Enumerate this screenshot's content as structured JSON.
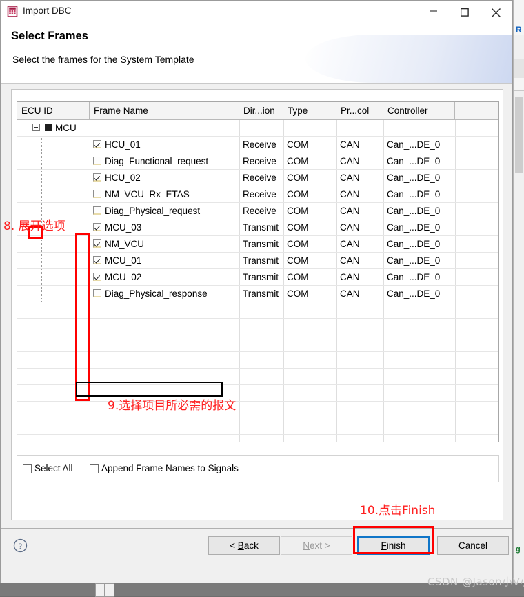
{
  "window": {
    "title": "Import DBC",
    "icon": "dbc-file-icon",
    "controls": {
      "minimize": "minimize-icon",
      "maximize": "maximize-icon",
      "close": "close-icon"
    }
  },
  "wizard": {
    "title": "Select Frames",
    "subtitle": "Select the frames for the System Template"
  },
  "group": {
    "label": "Select Frames"
  },
  "table": {
    "columns": [
      "ECU ID",
      "Frame Name",
      "Dir...ion",
      "Type",
      "Pr...col",
      "Controller",
      ""
    ],
    "root": {
      "label": "MCU",
      "expanded": true
    },
    "rows": [
      {
        "checked": true,
        "name": "HCU_01",
        "direction": "Receive",
        "type": "COM",
        "protocol": "CAN",
        "controller": "Can_...DE_0"
      },
      {
        "checked": false,
        "name": "Diag_Functional_request",
        "direction": "Receive",
        "type": "COM",
        "protocol": "CAN",
        "controller": "Can_...DE_0"
      },
      {
        "checked": true,
        "name": "HCU_02",
        "direction": "Receive",
        "type": "COM",
        "protocol": "CAN",
        "controller": "Can_...DE_0"
      },
      {
        "checked": false,
        "name": "NM_VCU_Rx_ETAS",
        "direction": "Receive",
        "type": "COM",
        "protocol": "CAN",
        "controller": "Can_...DE_0"
      },
      {
        "checked": false,
        "name": "Diag_Physical_request",
        "direction": "Receive",
        "type": "COM",
        "protocol": "CAN",
        "controller": "Can_...DE_0"
      },
      {
        "checked": true,
        "name": "MCU_03",
        "direction": "Transmit",
        "type": "COM",
        "protocol": "CAN",
        "controller": "Can_...DE_0"
      },
      {
        "checked": true,
        "name": "NM_VCU",
        "direction": "Transmit",
        "type": "COM",
        "protocol": "CAN",
        "controller": "Can_...DE_0"
      },
      {
        "checked": true,
        "name": "MCU_01",
        "direction": "Transmit",
        "type": "COM",
        "protocol": "CAN",
        "controller": "Can_...DE_0"
      },
      {
        "checked": true,
        "name": "MCU_02",
        "direction": "Transmit",
        "type": "COM",
        "protocol": "CAN",
        "controller": "Can_...DE_0"
      },
      {
        "checked": false,
        "name": "Diag_Physical_response",
        "direction": "Transmit",
        "type": "COM",
        "protocol": "CAN",
        "controller": "Can_...DE_0",
        "focused": true
      }
    ]
  },
  "options": {
    "select_all": {
      "label": "Select All",
      "checked": false
    },
    "append_frame_names": {
      "label": "Append Frame Names to Signals",
      "checked": false
    }
  },
  "buttons": {
    "help": "help-icon",
    "back": "< Back",
    "back_mnemonic": "B",
    "next": "Next >",
    "next_mnemonic": "N",
    "finish": "Finish",
    "finish_mnemonic": "F",
    "cancel": "Cancel"
  },
  "annotations": {
    "step8": "8. 展开选项",
    "step9": "9.选择项目所必需的报文",
    "step10": "10.点击Finish",
    "color": "#ff2020"
  },
  "background": {
    "blue_text": "R",
    "green_text": "g"
  },
  "watermark": "CSDN @Jason小V小"
}
